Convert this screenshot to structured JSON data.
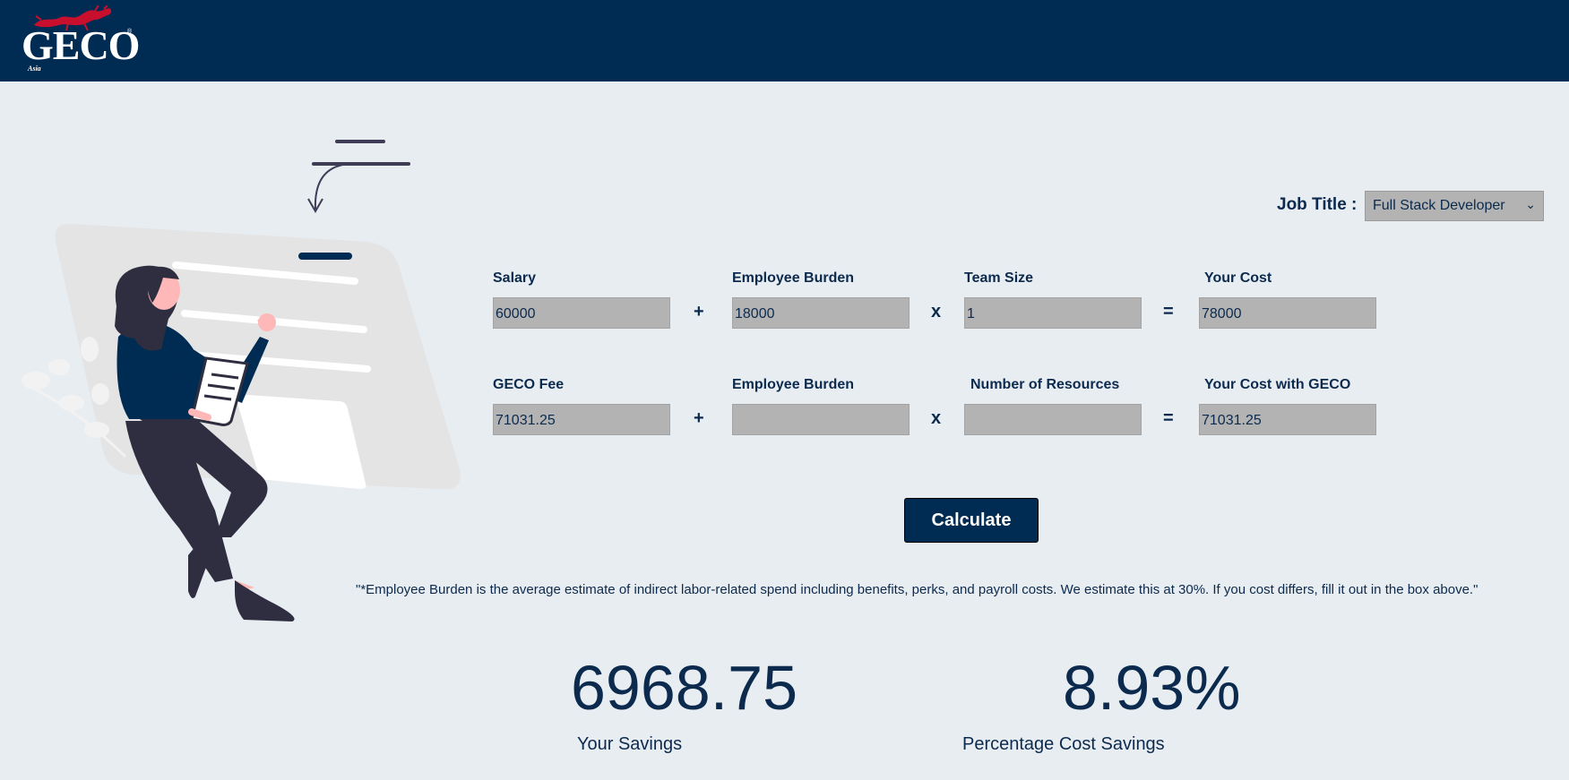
{
  "header": {
    "logo_text": "GECO",
    "logo_registered": "®",
    "logo_sub": "Asia",
    "brand_color": "#002b52"
  },
  "job": {
    "label": "Job Title :",
    "selected": "Full Stack Developer"
  },
  "row1": {
    "salary_label": "Salary",
    "salary_value": "60000",
    "burden_label": "Employee Burden",
    "burden_value": "18000",
    "team_label": "Team Size",
    "team_value": "1",
    "cost_label": "Your Cost",
    "cost_value": "78000"
  },
  "row2": {
    "fee_label": "GECO Fee",
    "fee_value": "71031.25",
    "burden_label": "Employee Burden",
    "burden_value": "",
    "resources_label": "Number of Resources",
    "resources_value": "",
    "cost_label": "Your Cost with GECO",
    "cost_value": "71031.25"
  },
  "operators": {
    "plus": "+",
    "times": "x",
    "equals": "="
  },
  "calculate_label": "Calculate",
  "note": "\"*Employee Burden is the average estimate of indirect labor-related spend including benefits, perks, and payroll costs. We estimate this at 30%. If you cost differs, fill it out in the box above.\"",
  "results": {
    "savings_value": "6968.75",
    "savings_label": "Your Savings",
    "percent_value": "8.93%",
    "percent_label": "Percentage Cost Savings"
  }
}
